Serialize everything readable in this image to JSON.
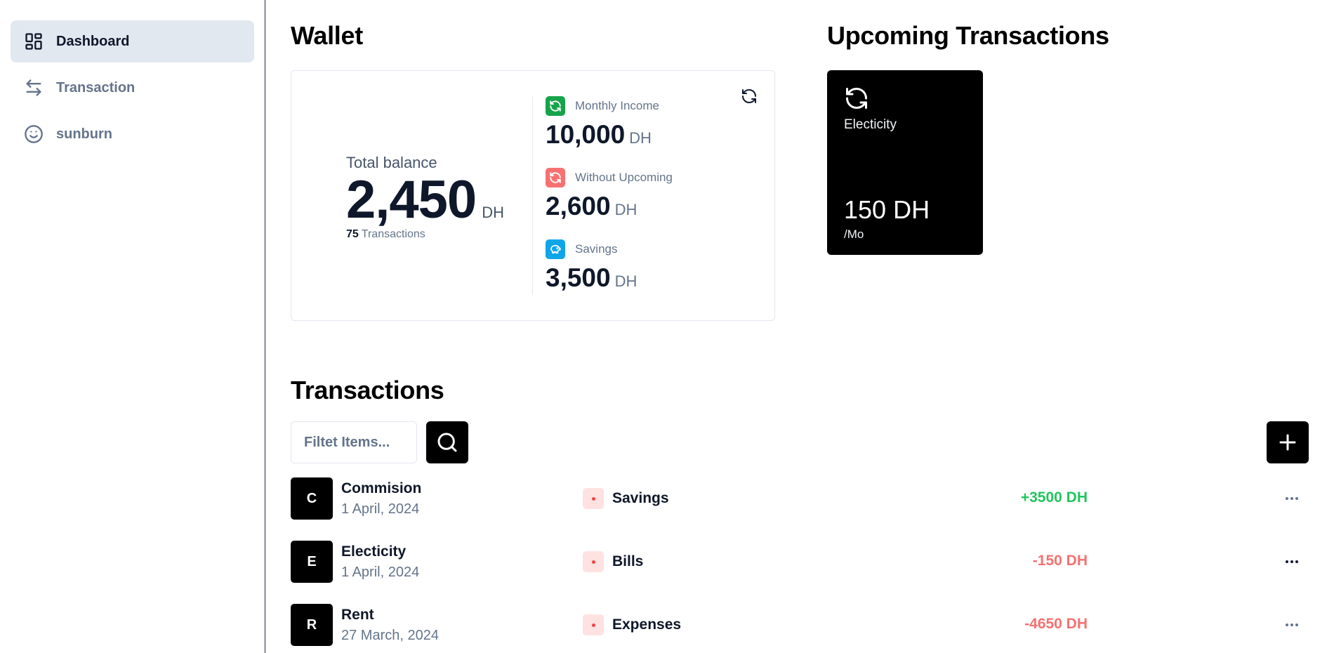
{
  "sidebar": {
    "items": [
      {
        "label": "Dashboard",
        "icon": "dashboard-icon",
        "active": true
      },
      {
        "label": "Transaction",
        "icon": "arrows-swap-icon",
        "active": false
      },
      {
        "label": "sunburn",
        "icon": "smiley-icon",
        "active": false
      }
    ]
  },
  "wallet": {
    "title": "Wallet",
    "total_label": "Total balance",
    "total_amount": "2,450",
    "currency": "DH",
    "tx_count": "75",
    "tx_count_label": "Transactions",
    "stats": [
      {
        "label": "Monthly Income",
        "value": "10,000",
        "currency": "DH",
        "icon_color": "#16a34a"
      },
      {
        "label": "Without Upcoming",
        "value": "2,600",
        "currency": "DH",
        "icon_color": "#f87171"
      },
      {
        "label": "Savings",
        "value": "3,500",
        "currency": "DH",
        "icon_color": "#0ea5e9"
      }
    ]
  },
  "upcoming": {
    "title": "Upcoming Transactions",
    "cards": [
      {
        "name": "Electicity",
        "amount": "150 DH",
        "period": "/Mo"
      }
    ]
  },
  "transactions": {
    "title": "Transactions",
    "filter_placeholder": "Filtet Items...",
    "rows": [
      {
        "initial": "C",
        "name": "Commision",
        "date": "1 April, 2024",
        "category": "Savings",
        "amount": "+3500 DH",
        "positive": true
      },
      {
        "initial": "E",
        "name": "Electicity",
        "date": "1 April, 2024",
        "category": "Bills",
        "amount": "-150 DH",
        "positive": false
      },
      {
        "initial": "R",
        "name": "Rent",
        "date": "27 March, 2024",
        "category": "Expenses",
        "amount": "-4650 DH",
        "positive": false
      }
    ]
  },
  "colors": {
    "positive": "#22c55e",
    "negative": "#f87171",
    "accent_dark": "#000000"
  }
}
